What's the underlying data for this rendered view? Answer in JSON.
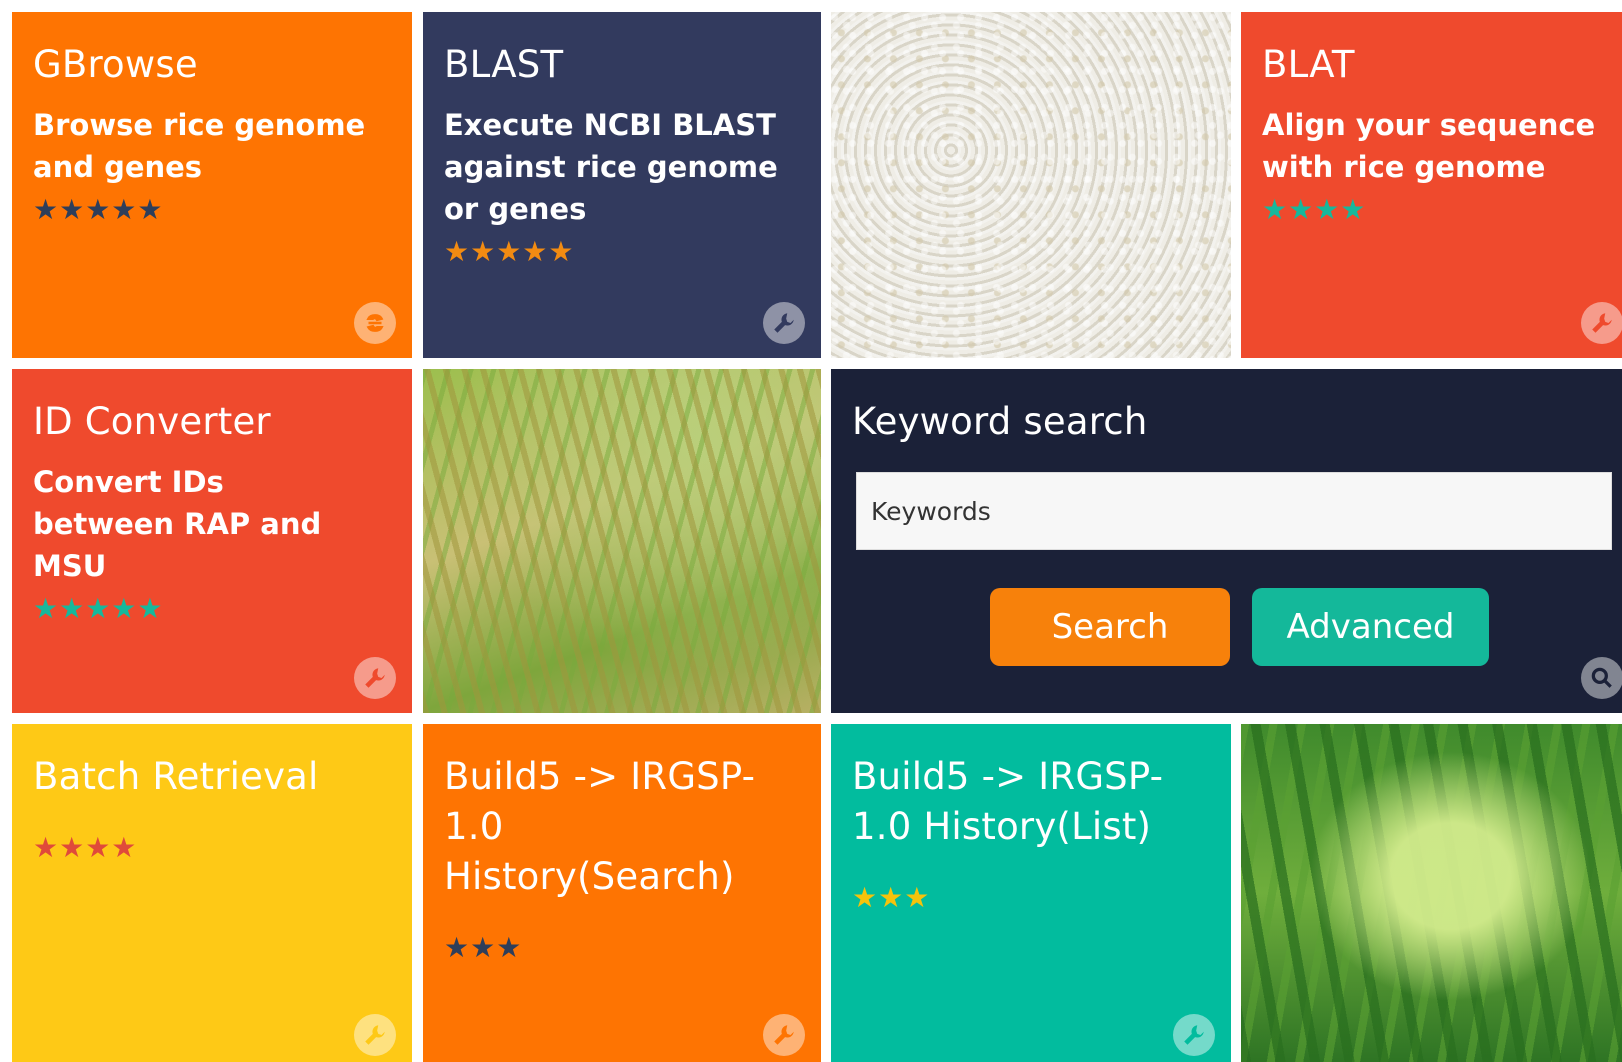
{
  "colors": {
    "orange": "#fe7402",
    "navy": "#323a5e",
    "red": "#ef4a2d",
    "dark_navy": "#1b2138",
    "yellow": "#fec916",
    "teal": "#02bc9e"
  },
  "tiles": [
    {
      "title": "GBrowse",
      "desc": "Browse rice genome and genes",
      "stars": "★★★★★",
      "rating": 5,
      "icon": "gbrowse-icon"
    },
    {
      "title": "BLAST",
      "desc": "Execute NCBI BLAST against rice genome or genes",
      "stars": "★★★★★",
      "rating": 5,
      "icon": "wrench-icon"
    },
    {
      "title": "BLAT",
      "desc": "Align your sequence with rice genome",
      "stars": "★★★★",
      "rating": 4,
      "icon": "wrench-icon"
    },
    {
      "title": "ID Converter",
      "desc": "Convert IDs between RAP and MSU",
      "stars": "★★★★★",
      "rating": 5,
      "icon": "wrench-icon"
    },
    {
      "title": "Batch Retrieval",
      "desc": "",
      "stars": "★★★★",
      "rating": 4,
      "icon": "wrench-icon"
    },
    {
      "title": "Build5 -> IRGSP-1.0 History(Search)",
      "desc": "",
      "stars": "★★★",
      "rating": 3,
      "icon": "wrench-icon"
    },
    {
      "title": "Build5 -> IRGSP-1.0 History(List)",
      "desc": "",
      "stars": "★★★",
      "rating": 3,
      "icon": "wrench-icon"
    }
  ],
  "keyword_search": {
    "title": "Keyword search",
    "placeholder": "Keywords",
    "search_label": "Search",
    "advanced_label": "Advanced",
    "icon": "search-icon"
  }
}
